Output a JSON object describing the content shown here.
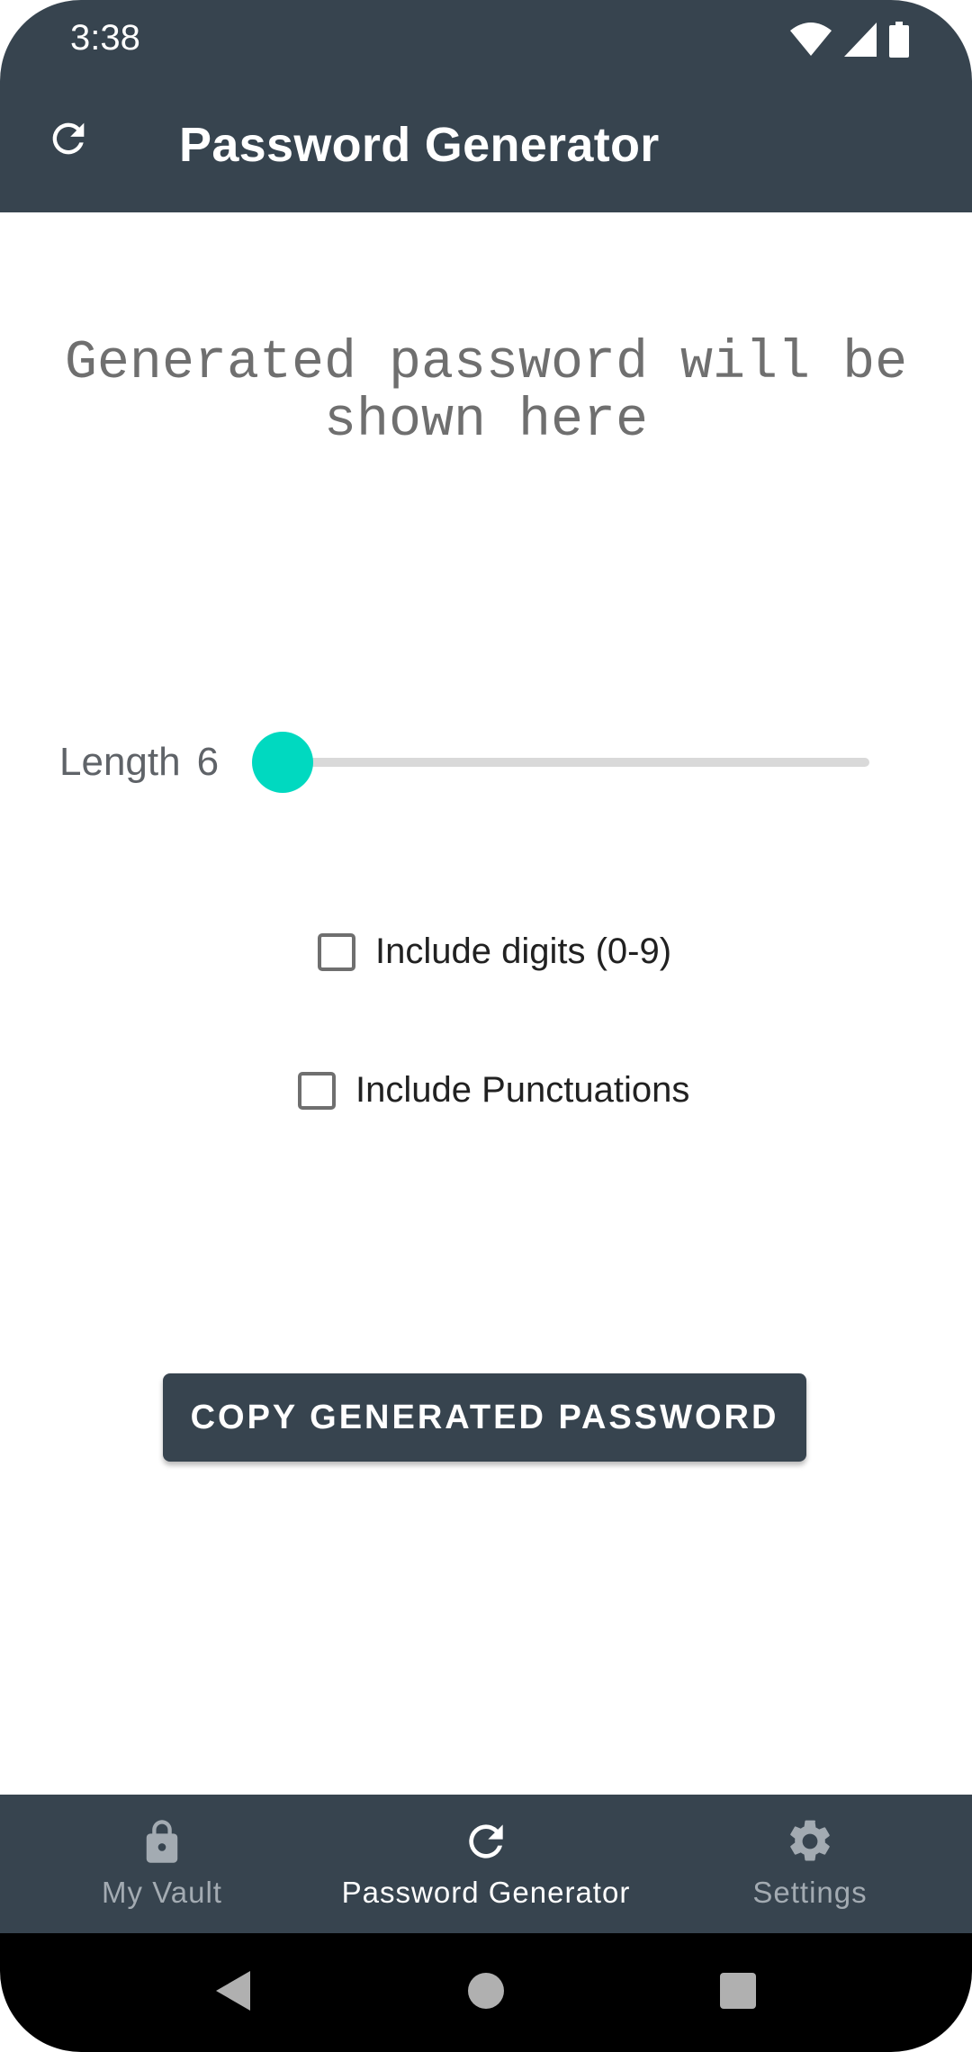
{
  "status_bar": {
    "time": "3:38",
    "icons": [
      "wifi-icon",
      "signal-icon",
      "battery-icon"
    ]
  },
  "app_bar": {
    "title": "Password Generator",
    "refresh_icon": "refresh-icon"
  },
  "password": {
    "display_text": "Generated password will be shown here"
  },
  "length": {
    "label": "Length",
    "value": "6",
    "slider_fraction": 0.0
  },
  "options": {
    "digits": {
      "label": "Include digits (0-9)",
      "checked": false
    },
    "punctuations": {
      "label": "Include Punctuations",
      "checked": false
    }
  },
  "copy_button": {
    "label": "COPY GENERATED PASSWORD"
  },
  "bottom_nav": {
    "items": [
      {
        "label": "My Vault",
        "icon": "lock-icon",
        "active": false
      },
      {
        "label": "Password Generator",
        "icon": "refresh-icon",
        "active": true
      },
      {
        "label": "Settings",
        "icon": "gear-icon",
        "active": false
      }
    ]
  },
  "system_nav": {
    "buttons": [
      "back-icon",
      "home-icon",
      "recents-icon"
    ]
  },
  "colors": {
    "primary": "#37444f",
    "accent": "#00d9c0"
  }
}
